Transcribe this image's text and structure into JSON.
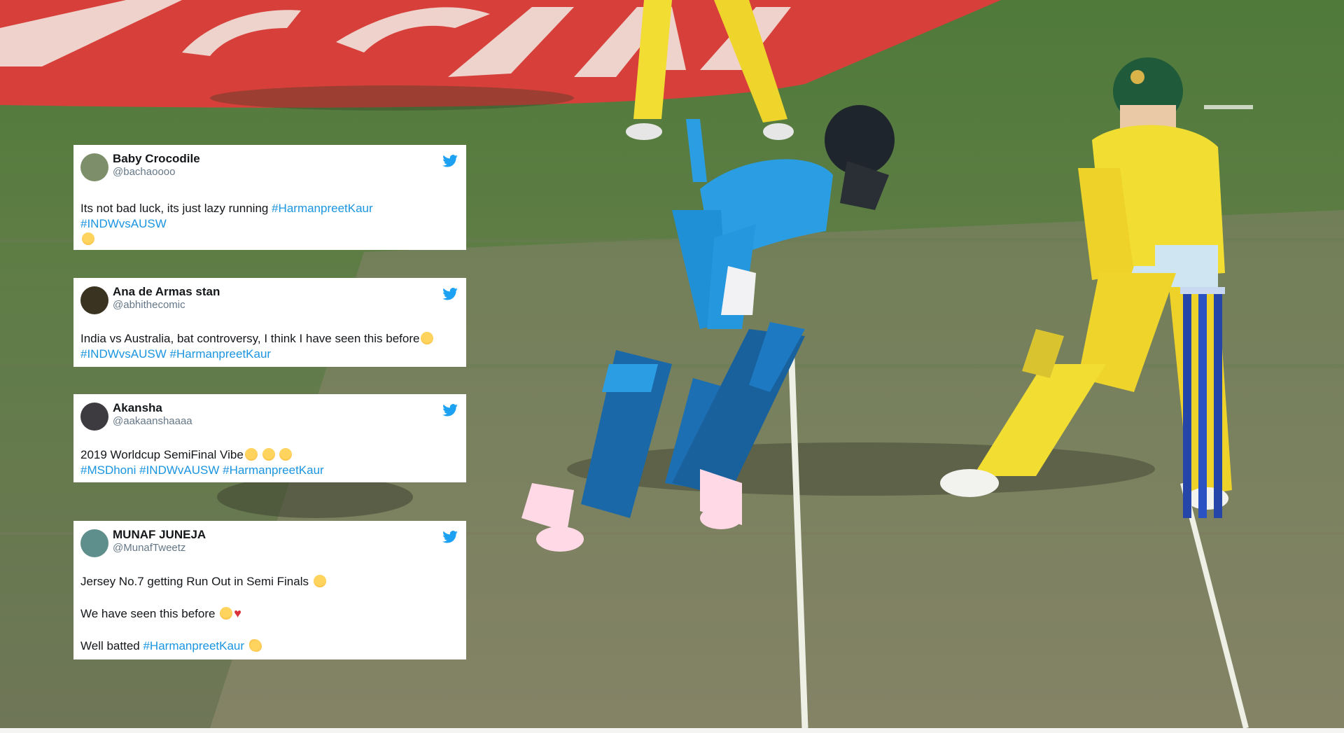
{
  "scene": {
    "colors": {
      "grass": "#5c7a43",
      "pitch": "#8a8a68",
      "signage": "#d7403a",
      "india_kit": "#2b9ee3",
      "aus_kit": "#f2dd33",
      "helmet_aus": "#1f5b3a"
    }
  },
  "tweets": [
    {
      "name": "Baby Crocodile",
      "handle": "@bachaoooo",
      "avatar_color": "#7d8f6a",
      "lines": [
        {
          "text": "Its not bad luck, its just lazy running ",
          "tag": "#HarmanpreetKaur"
        },
        {
          "tag": "#INDWvsAUSW"
        }
      ],
      "emoji_line": "worried-face"
    },
    {
      "name": "Ana de Armas stan",
      "handle": "@abhithecomic",
      "avatar_color": "#3a3322",
      "lines": [
        {
          "text": "India vs Australia, bat controversy, I think I have seen this before",
          "emoji": "crying-face"
        },
        {
          "tag": "#INDWvsAUSW",
          "tag2": "#HarmanpreetKaur"
        }
      ]
    },
    {
      "name": "Akansha ",
      "handle": "@aakaanshaaaa",
      "avatar_color": "#3d3a40",
      "lines": [
        {
          "text": "2019 Worldcup SemiFinal Vibe",
          "emoji": "crying-face x3"
        },
        {
          "tag": "#MSDhoni",
          "tag2": "#INDWvAUSW",
          "tag3": "#HarmanpreetKaur"
        }
      ]
    },
    {
      "name": "MUNAF JUNEJA",
      "handle": "@MunafTweetz",
      "avatar_color": "#5f8f8d",
      "paragraphs": [
        {
          "text": "Jersey No.7 getting Run Out in Semi Finals ",
          "emoji": "sad-face"
        },
        {
          "text": "We have seen this before ",
          "emoji": "disappointed-face broken-heart"
        },
        {
          "text": "Well batted ",
          "tag": "#HarmanpreetKaur",
          "emoji": "clapping-hands"
        }
      ]
    }
  ]
}
